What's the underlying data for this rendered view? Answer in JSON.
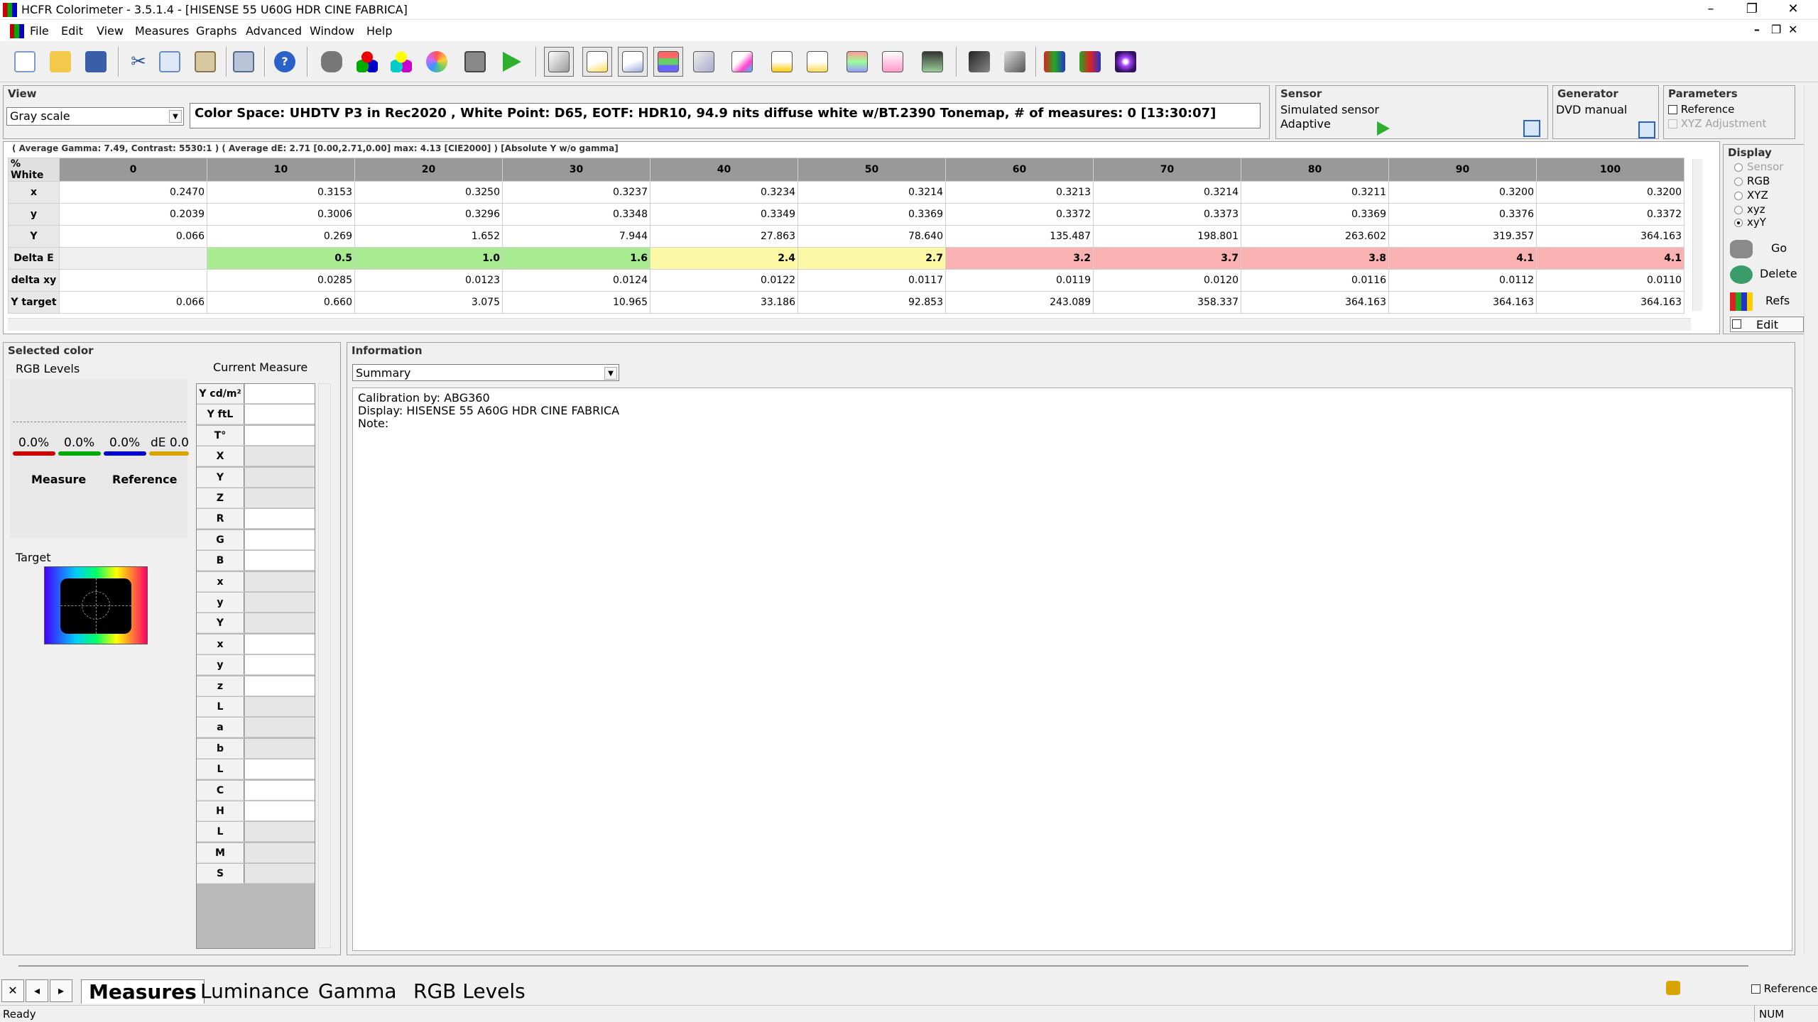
{
  "window": {
    "title": "HCFR Colorimeter - 3.5.1.4 - [HISENSE 55 U60G HDR CINE FABRICA]",
    "controls": [
      "–",
      "❐",
      "✕"
    ],
    "mdi_controls": [
      "–",
      "❐",
      "✕"
    ]
  },
  "menu": [
    "File",
    "Edit",
    "View",
    "Measures",
    "Graphs",
    "Advanced",
    "Window",
    "Help"
  ],
  "toolbar": {
    "icons": [
      "new-file",
      "open-folder",
      "save",
      "cut",
      "copy",
      "paste",
      "print",
      "help",
      "sensor-probe",
      "rgb-primaries",
      "secondaries",
      "color-checker",
      "camera",
      "play",
      "gray-scale-view",
      "luminance-graph",
      "gamma-graph",
      "rgb-levels-graph",
      "cie-diagram",
      "color-temp",
      "near-black",
      "near-white",
      "saturation",
      "saturation-luma",
      "color-comparator",
      "measure-sat-1",
      "measure-sat-2",
      "rgb-film-1",
      "rgb-film-2",
      "purple-star"
    ]
  },
  "view": {
    "title": "View",
    "mode": "Gray scale",
    "info": "Color Space: UHDTV P3 in Rec2020 , White Point: D65, EOTF:  HDR10, 94.9 nits diffuse white w/BT.2390 Tonemap, # of measures: 0 [13:30:07]"
  },
  "sensor": {
    "title": "Sensor",
    "name": "Simulated sensor",
    "mode": "Adaptive"
  },
  "generator": {
    "title": "Generator",
    "name": "DVD manual"
  },
  "parameters": {
    "title": "Parameters",
    "reference": "Reference",
    "xyz_adjust": "XYZ Adjustment"
  },
  "table": {
    "info": "( Average Gamma: 7.49, Contrast: 5530:1 ) ( Average dE: 2.71 [0.00,2.71,0.00] max: 4.13 [CIE2000] ) [Absolute Y w/o gamma]",
    "corner": "% White",
    "columns": [
      "0",
      "10",
      "20",
      "30",
      "40",
      "50",
      "60",
      "70",
      "80",
      "90",
      "100"
    ],
    "rows": [
      {
        "label": "x",
        "values": [
          "0.2470",
          "0.3153",
          "0.3250",
          "0.3237",
          "0.3234",
          "0.3214",
          "0.3213",
          "0.3214",
          "0.3211",
          "0.3200",
          "0.3200"
        ]
      },
      {
        "label": "y",
        "values": [
          "0.2039",
          "0.3006",
          "0.3296",
          "0.3348",
          "0.3349",
          "0.3369",
          "0.3372",
          "0.3373",
          "0.3369",
          "0.3376",
          "0.3372"
        ]
      },
      {
        "label": "Y",
        "values": [
          "0.066",
          "0.269",
          "1.652",
          "7.944",
          "27.863",
          "78.640",
          "135.487",
          "198.801",
          "263.602",
          "319.357",
          "364.163"
        ]
      },
      {
        "label": "Delta E",
        "values": [
          "",
          "0.5",
          "1.0",
          "1.6",
          "2.4",
          "2.7",
          "3.2",
          "3.7",
          "3.8",
          "4.1",
          "4.1"
        ]
      },
      {
        "label": "delta xy",
        "values": [
          "",
          "0.0285",
          "0.0123",
          "0.0124",
          "0.0122",
          "0.0117",
          "0.0119",
          "0.0120",
          "0.0116",
          "0.0112",
          "0.0110"
        ]
      },
      {
        "label": "Y target",
        "values": [
          "0.066",
          "0.660",
          "3.075",
          "10.965",
          "33.186",
          "92.853",
          "243.089",
          "358.337",
          "364.163",
          "364.163",
          "364.163"
        ]
      }
    ],
    "delta_colors": [
      "#f0f0f0",
      "#a8eb90",
      "#a8eb90",
      "#a8eb90",
      "#fbf8a6",
      "#fbf8a6",
      "#f9b1b1",
      "#f9b1b1",
      "#f9b1b1",
      "#f9b1b1",
      "#f9b1b1"
    ]
  },
  "display": {
    "title": "Display",
    "options": [
      "Sensor",
      "RGB",
      "XYZ",
      "xyz",
      "xyY"
    ],
    "selected": "xyY",
    "buttons": [
      "Go",
      "Delete",
      "Refs",
      "Edit"
    ]
  },
  "selected_color": {
    "title": "Selected color",
    "rgb_levels": "RGB Levels",
    "current_measure": "Current Measure",
    "r": "0.0%",
    "g": "0.0%",
    "b": "0.0%",
    "de": "dE 0.0",
    "measure": "Measure",
    "reference": "Reference",
    "target": "Target",
    "grid_labels": [
      "Y cd/m²",
      "Y ftL",
      "T°",
      "X",
      "Y",
      "Z",
      "R",
      "G",
      "B",
      "x",
      "y",
      "Y",
      "x",
      "y",
      "z",
      "L",
      "a",
      "b",
      "L",
      "C",
      "H",
      "L",
      "M",
      "S"
    ]
  },
  "information": {
    "title": "Information",
    "mode": "Summary",
    "text": "Calibration by: ABG360\nDisplay: HISENSE 55 A60G HDR CINE FABRICA\nNote:"
  },
  "tabs": {
    "nav": [
      "✕",
      "◂",
      "▸"
    ],
    "items": [
      "Measures",
      "Luminance",
      "Gamma",
      "RGB Levels"
    ],
    "active": "Measures"
  },
  "status": {
    "left": "Ready",
    "num": "NUM",
    "reference": "Reference"
  }
}
